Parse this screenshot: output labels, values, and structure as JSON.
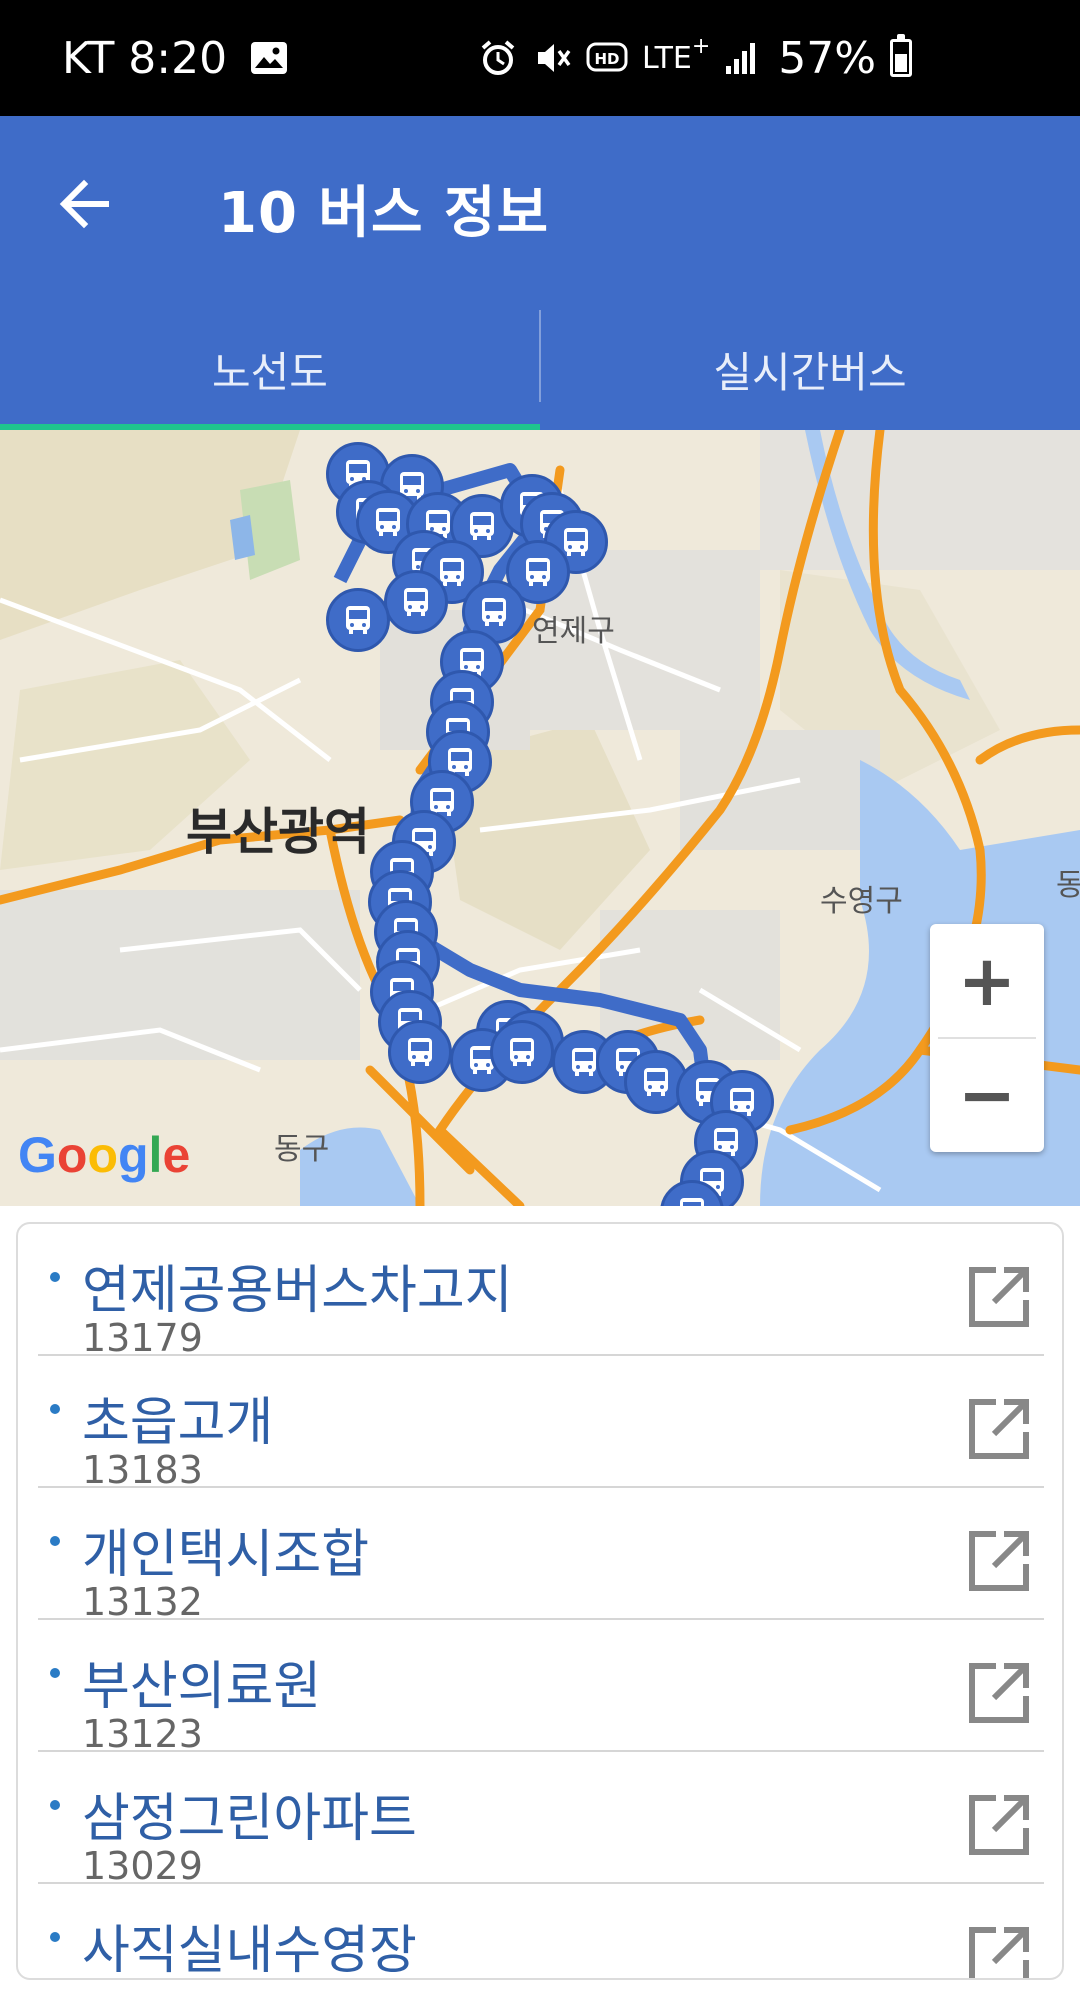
{
  "status_bar": {
    "carrier_time": "KT 8:20",
    "network": "LTE",
    "battery": "57%",
    "battery_level": 0.57,
    "icons": [
      "image-icon",
      "alarm-icon",
      "mute-icon",
      "hd-icon",
      "lte-icon",
      "signal-icon",
      "battery-icon"
    ]
  },
  "app_bar": {
    "title": "10 버스 정보",
    "back_icon": "arrow-back-icon"
  },
  "tabs": [
    {
      "label": "노선도",
      "selected": true
    },
    {
      "label": "실시간버스",
      "selected": false
    }
  ],
  "map": {
    "labels": {
      "district_yeonje": "연제구",
      "city_busan": "부산광역",
      "district_suyeong": "수영구",
      "district_dong": "동구",
      "edge": "동"
    },
    "attribution": "Google",
    "zoom_in": "+",
    "zoom_out": "−",
    "route_color": "#3F6CC8"
  },
  "stops": [
    {
      "name": "연제공용버스차고지",
      "id": "13179"
    },
    {
      "name": "초읍고개",
      "id": "13183"
    },
    {
      "name": "개인택시조합",
      "id": "13132"
    },
    {
      "name": "부산의료원",
      "id": "13123"
    },
    {
      "name": "삼정그린아파트",
      "id": "13029"
    },
    {
      "name": "사직실내수영장",
      "id": ""
    }
  ],
  "colors": {
    "primary": "#3F6CC8",
    "tab_indicator": "#1FC48D",
    "stop_name": "#2F5FA6"
  }
}
